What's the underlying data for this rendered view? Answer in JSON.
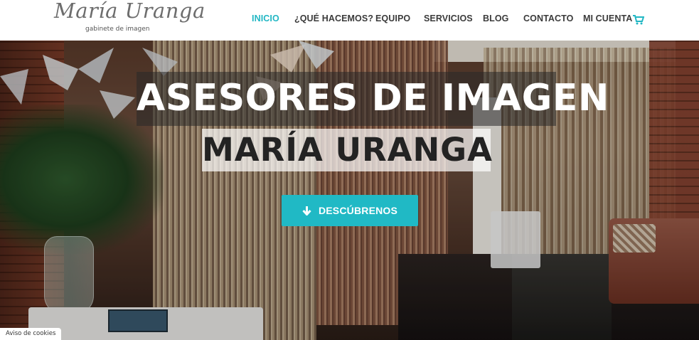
{
  "logo": {
    "script_text": "María Uranga",
    "subtitle": "gabinete de imagen"
  },
  "nav": {
    "items": [
      {
        "label": "INICIO",
        "active": true
      },
      {
        "label": "¿QUÉ HACEMOS?",
        "active": false
      },
      {
        "label": "EQUIPO",
        "active": false
      },
      {
        "label": "SERVICIOS",
        "active": false
      },
      {
        "label": "BLOG",
        "active": false
      },
      {
        "label": "CONTACTO",
        "active": false
      },
      {
        "label": "MI CUENTA",
        "active": false
      }
    ],
    "cart_icon": "shopping-cart-icon"
  },
  "hero": {
    "title_line1": "ASESORES DE IMAGEN",
    "title_line2": "MARÍA URANGA",
    "cta_label": "DESCÚBRENOS",
    "cta_icon": "arrow-down-icon"
  },
  "cookie_notice": "Aviso de cookies",
  "colors": {
    "accent": "#20b9c5",
    "nav_text": "#3b3b3b",
    "active_nav": "#22b7c4"
  }
}
